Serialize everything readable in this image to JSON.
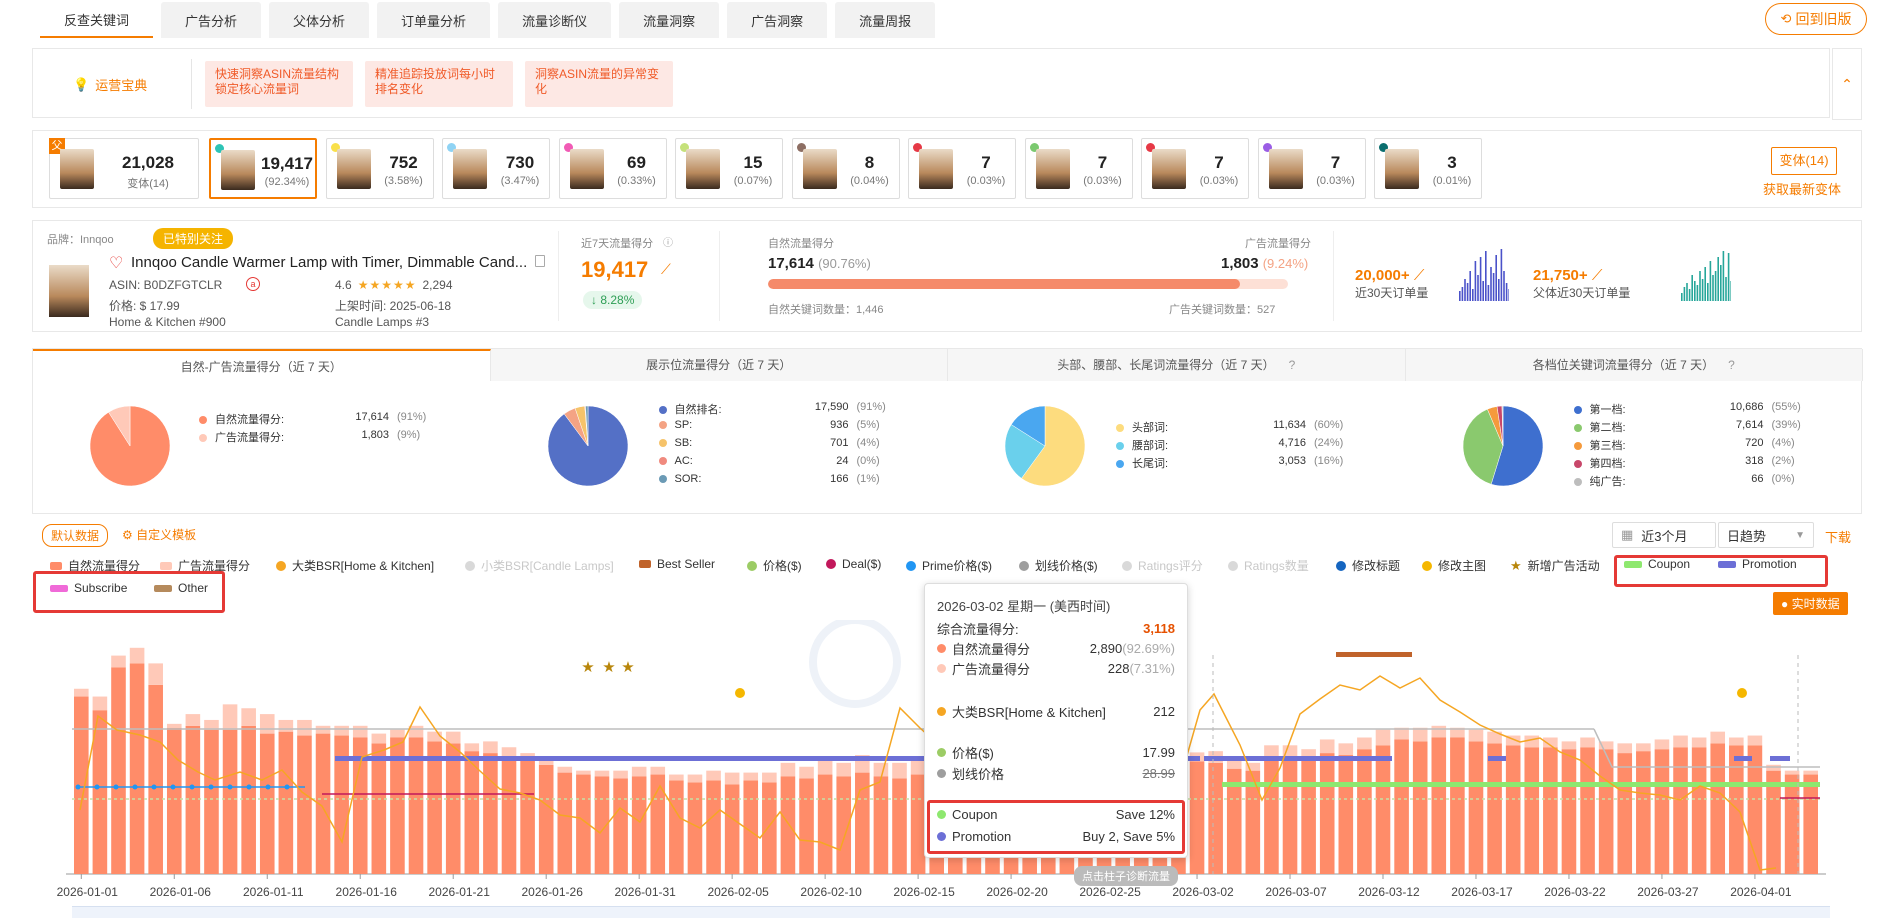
{
  "tabs": [
    "反查关键词",
    "广告分析",
    "父体分析",
    "订单量分析",
    "流量诊断仪",
    "流量洞察",
    "广告洞察",
    "流量周报"
  ],
  "old_version": "回到旧版",
  "tips": {
    "title": "运营宝典",
    "items": [
      "快速洞察ASIN流量结构锁定核心流量词",
      "精准追踪投放词每小时排名变化",
      "洞察ASIN流量的异常变化"
    ]
  },
  "parent_card": {
    "badge": "父",
    "value": "21,028",
    "label": "变体(14)"
  },
  "variants": [
    {
      "value": "19,417",
      "pct": "(92.34%)",
      "dot": "#2ec4b6"
    },
    {
      "value": "752",
      "pct": "(3.58%)",
      "dot": "#f9e04b"
    },
    {
      "value": "730",
      "pct": "(3.47%)",
      "dot": "#8fd3f4"
    },
    {
      "value": "69",
      "pct": "(0.33%)",
      "dot": "#f15bb5"
    },
    {
      "value": "15",
      "pct": "(0.07%)",
      "dot": "#c5e17a"
    },
    {
      "value": "8",
      "pct": "(0.04%)",
      "dot": "#8d6e63"
    },
    {
      "value": "7",
      "pct": "(0.03%)",
      "dot": "#e63946"
    },
    {
      "value": "7",
      "pct": "(0.03%)",
      "dot": "#7bc96f"
    },
    {
      "value": "7",
      "pct": "(0.03%)",
      "dot": "#e63946"
    },
    {
      "value": "7",
      "pct": "(0.03%)",
      "dot": "#9b5de5"
    },
    {
      "value": "3",
      "pct": "(0.01%)",
      "dot": "#0b6e6e"
    }
  ],
  "variant_btn": "变体(14)",
  "get_latest": "获取最新变体",
  "product": {
    "brand_label": "品牌：Innqoo",
    "followed": "已特别关注",
    "title": "Innqoo Candle Warmer Lamp with Timer, Dimmable Cand...",
    "asin": "ASIN:   B0DZFGTCLR",
    "rating": "4.6",
    "stars": "★★★★★",
    "reviews": "2,294",
    "price": "价格:    $ 17.99",
    "list_date": "上架时间:     2025-06-18",
    "category": "Home & Kitchen  #900",
    "subcategory": "Candle Lamps  #3"
  },
  "score7": {
    "label": "近7天流量得分",
    "value": "19,417",
    "change": "8.28%"
  },
  "organic_ad": {
    "organic_label": "自然流量得分",
    "ad_label": "广告流量得分",
    "organic_value": "17,614",
    "organic_pct": "(90.76%)",
    "ad_value": "1,803",
    "ad_pct": "(9.24%)",
    "organic_share": 0.9076,
    "organic_kw": "自然关键词数量：1,446",
    "ad_kw": "广告关键词数量：527"
  },
  "orders": [
    {
      "value": "20,000+",
      "label": "近30天订单量",
      "color": "#4a52c9"
    },
    {
      "value": "21,750+",
      "label": "父体近30天订单量",
      "color": "#26a69a"
    }
  ],
  "pies": [
    {
      "title": "自然-广告流量得分（近 7 天）",
      "items": [
        {
          "name": "自然流量得分:",
          "value": "17,614",
          "pct": "(91%)",
          "color": "#ff8c69",
          "share": 0.91
        },
        {
          "name": "广告流量得分:",
          "value": "1,803",
          "pct": "(9%)",
          "color": "#ffc9b8",
          "share": 0.09
        }
      ]
    },
    {
      "title": "展示位流量得分（近 7 天）",
      "items": [
        {
          "name": "自然排名:",
          "value": "17,590",
          "pct": "(91%)",
          "color": "#5470c6",
          "share": 0.91
        },
        {
          "name": "SP:",
          "value": "936",
          "pct": "(5%)",
          "color": "#f4a384",
          "share": 0.05
        },
        {
          "name": "SB:",
          "value": "701",
          "pct": "(4%)",
          "color": "#f6c36a",
          "share": 0.04
        },
        {
          "name": "AC:",
          "value": "24",
          "pct": "(0%)",
          "color": "#f08a7e",
          "share": 0.003
        },
        {
          "name": "SOR:",
          "value": "166",
          "pct": "(1%)",
          "color": "#6b9ab5",
          "share": 0.01
        }
      ]
    },
    {
      "title": "头部、腰部、长尾词流量得分（近 7 天）",
      "items": [
        {
          "name": "头部词:",
          "value": "11,634",
          "pct": "(60%)",
          "color": "#fddc7e",
          "share": 0.6
        },
        {
          "name": "腰部词:",
          "value": "4,716",
          "pct": "(24%)",
          "color": "#6ad0ec",
          "share": 0.24
        },
        {
          "name": "长尾词:",
          "value": "3,053",
          "pct": "(16%)",
          "color": "#4aa7f0",
          "share": 0.16
        }
      ]
    },
    {
      "title": "各档位关键词流量得分（近 7 天）",
      "items": [
        {
          "name": "第一档:",
          "value": "10,686",
          "pct": "(55%)",
          "color": "#3e6fcf",
          "share": 0.55
        },
        {
          "name": "第二档:",
          "value": "7,614",
          "pct": "(39%)",
          "color": "#8ac96e",
          "share": 0.39
        },
        {
          "name": "第三档:",
          "value": "720",
          "pct": "(4%)",
          "color": "#f59a3c",
          "share": 0.04
        },
        {
          "name": "第四档:",
          "value": "318",
          "pct": "(2%)",
          "color": "#c8476a",
          "share": 0.02
        },
        {
          "name": "纯广告:",
          "value": "66",
          "pct": "(0%)",
          "color": "#bdbdbd",
          "share": 0.004
        }
      ]
    }
  ],
  "controls": {
    "default_data": "默认数据",
    "custom_template": "自定义模板",
    "date_range": "近3个月",
    "trend": "日趋势",
    "download": "下载",
    "realtime": "实时数据"
  },
  "series_legend": [
    {
      "name": "自然流量得分",
      "color": "#ff8c69",
      "shape": "rect",
      "dim": false
    },
    {
      "name": "广告流量得分",
      "color": "#ffc9b8",
      "shape": "rect",
      "dim": false
    },
    {
      "name": "大类BSR[Home & Kitchen]",
      "color": "#f5a623",
      "shape": "circle",
      "dim": false
    },
    {
      "name": "小类BSR[Candle Lamps]",
      "color": "#d9d9d9",
      "shape": "circle",
      "dim": true
    },
    {
      "name": "Best Seller",
      "color": "#c0632b",
      "shape": "rect",
      "dim": false
    },
    {
      "name": "价格($)",
      "color": "#9ccc65",
      "shape": "circle",
      "dim": false
    },
    {
      "name": "Deal($)",
      "color": "#c2185b",
      "shape": "circle",
      "dim": false
    },
    {
      "name": "Prime价格($)",
      "color": "#2196f3",
      "shape": "circle",
      "dim": false
    },
    {
      "name": "划线价格($)",
      "color": "#9e9e9e",
      "shape": "circle",
      "dim": false
    },
    {
      "name": "Ratings评分",
      "color": "#d9d9d9",
      "shape": "circle",
      "dim": true
    },
    {
      "name": "Ratings数量",
      "color": "#d9d9d9",
      "shape": "circle",
      "dim": true
    },
    {
      "name": "修改标题",
      "color": "#1565c0",
      "shape": "circle",
      "dim": false
    },
    {
      "name": "修改主图",
      "color": "#f5b700",
      "shape": "circle",
      "dim": false
    },
    {
      "name": "新增广告活动",
      "color": "#b8860b",
      "shape": "star",
      "dim": false
    },
    {
      "name": "Coupon",
      "color": "#8ee86f",
      "shape": "rect",
      "dim": false
    },
    {
      "name": "Promotion",
      "color": "#6c6fd6",
      "shape": "rect",
      "dim": false
    },
    {
      "name": "Subscribe",
      "color": "#f06ad8",
      "shape": "rect",
      "dim": false
    },
    {
      "name": "Other",
      "color": "#b58a5c",
      "shape": "rect",
      "dim": false
    }
  ],
  "chart_data": {
    "type": "bar",
    "x_ticks": [
      "2026-01-01",
      "2026-01-06",
      "2026-01-11",
      "2026-01-16",
      "2026-01-21",
      "2026-01-26",
      "2026-01-31",
      "2026-02-05",
      "2026-02-10",
      "2026-02-15",
      "2026-02-20",
      "2026-02-25",
      "2026-03-02",
      "2026-03-07",
      "2026-03-12",
      "2026-03-17",
      "2026-03-22",
      "2026-03-27",
      "2026-04-01"
    ],
    "ylim": [
      0,
      6000
    ],
    "series": [
      {
        "name": "自然流量得分",
        "values": [
          4550,
          4200,
          5300,
          5400,
          4850,
          3750,
          3800,
          3700,
          3700,
          3800,
          3600,
          3650,
          3550,
          3600,
          3550,
          3500,
          3350,
          3500,
          3500,
          3400,
          3350,
          3150,
          3100,
          3000,
          2950,
          2800,
          2600,
          2550,
          2500,
          2450,
          2500,
          2550,
          2400,
          2350,
          2400,
          2300,
          2400,
          2350,
          2500,
          2450,
          2550,
          2500,
          2600,
          2500,
          2450,
          2550,
          2400,
          2600,
          2550,
          2450,
          2600,
          2550,
          2500,
          2650,
          2700,
          2750,
          2650,
          2700,
          2500,
          2600,
          2890,
          2850,
          2700,
          2650,
          3000,
          2950,
          2900,
          3100,
          3050,
          3200,
          3300,
          3450,
          3400,
          3500,
          3500,
          3400,
          3350,
          3300,
          3250,
          3250,
          3200,
          3250,
          3200,
          3100,
          3150,
          3200,
          3250,
          3250,
          3350,
          3300,
          3300,
          2650,
          2550,
          2550
        ]
      },
      {
        "name": "广告流量得分",
        "values": [
          200,
          350,
          300,
          400,
          550,
          100,
          300,
          250,
          650,
          450,
          500,
          300,
          400,
          200,
          250,
          300,
          250,
          200,
          300,
          250,
          300,
          200,
          300,
          250,
          150,
          200,
          150,
          100,
          150,
          200,
          250,
          200,
          150,
          200,
          250,
          300,
          200,
          250,
          350,
          300,
          400,
          350,
          450,
          350,
          400,
          350,
          400,
          450,
          400,
          350,
          400,
          350,
          300,
          350,
          400,
          450,
          350,
          450,
          300,
          300,
          228,
          300,
          250,
          200,
          300,
          350,
          300,
          350,
          300,
          300,
          400,
          300,
          350,
          300,
          250,
          300,
          300,
          250,
          300,
          250,
          200,
          250,
          200,
          250,
          200,
          250,
          300,
          250,
          300,
          200,
          250,
          150,
          100,
          100
        ]
      }
    ]
  },
  "tooltip": {
    "date": "2026-03-02 星期一 (美西时间)",
    "total_label": "综合流量得分:",
    "total_value": "3,118",
    "rows": [
      {
        "name": "自然流量得分",
        "value": "2,890",
        "pct": "(92.69%)",
        "color": "#ff8c69"
      },
      {
        "name": "广告流量得分",
        "value": "228",
        "pct": "(7.31%)",
        "color": "#ffc9b8"
      }
    ],
    "bsr": {
      "name": "大类BSR[Home & Kitchen]",
      "value": "212",
      "color": "#f5a623"
    },
    "price": {
      "name": "价格($)",
      "value": "17.99",
      "color": "#9ccc65"
    },
    "strike": {
      "name": "划线价格",
      "value": "28.99",
      "color": "#9e9e9e"
    },
    "coupon": {
      "name": "Coupon",
      "value": "Save 12%",
      "color": "#8ee86f"
    },
    "promotion": {
      "name": "Promotion",
      "value": "Buy 2, Save 5%",
      "color": "#6c6fd6"
    }
  },
  "diagnose_hint": "点击柱子诊断流量"
}
